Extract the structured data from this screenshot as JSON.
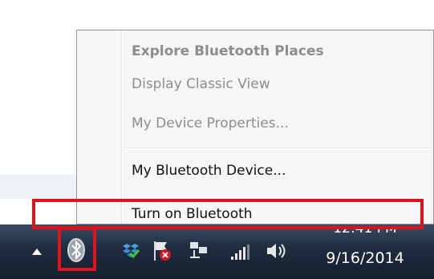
{
  "menu": {
    "items": [
      {
        "label": "Explore Bluetooth Places",
        "state": "disabled-bold"
      },
      {
        "label": "Display Classic View",
        "state": "disabled"
      },
      {
        "label": "My Device Properties...",
        "state": "disabled"
      },
      {
        "label": "My Bluetooth Device...",
        "state": "enabled"
      },
      {
        "label": "Turn on Bluetooth",
        "state": "enabled"
      }
    ]
  },
  "taskbar": {
    "clock_time": "12:41 PM",
    "clock_date": "9/16/2014",
    "tray_icons": [
      "show-hidden-icons-arrow",
      "bluetooth-icon",
      "dropbox-icon",
      "action-center-flag-icon",
      "network-icon",
      "signal-icon",
      "volume-icon"
    ]
  },
  "colors": {
    "highlight_box": "#d9141e",
    "taskbar": "#1f2c3f",
    "menu_bg": "#f5f6f7",
    "disabled_text": "#8d8d8d"
  }
}
